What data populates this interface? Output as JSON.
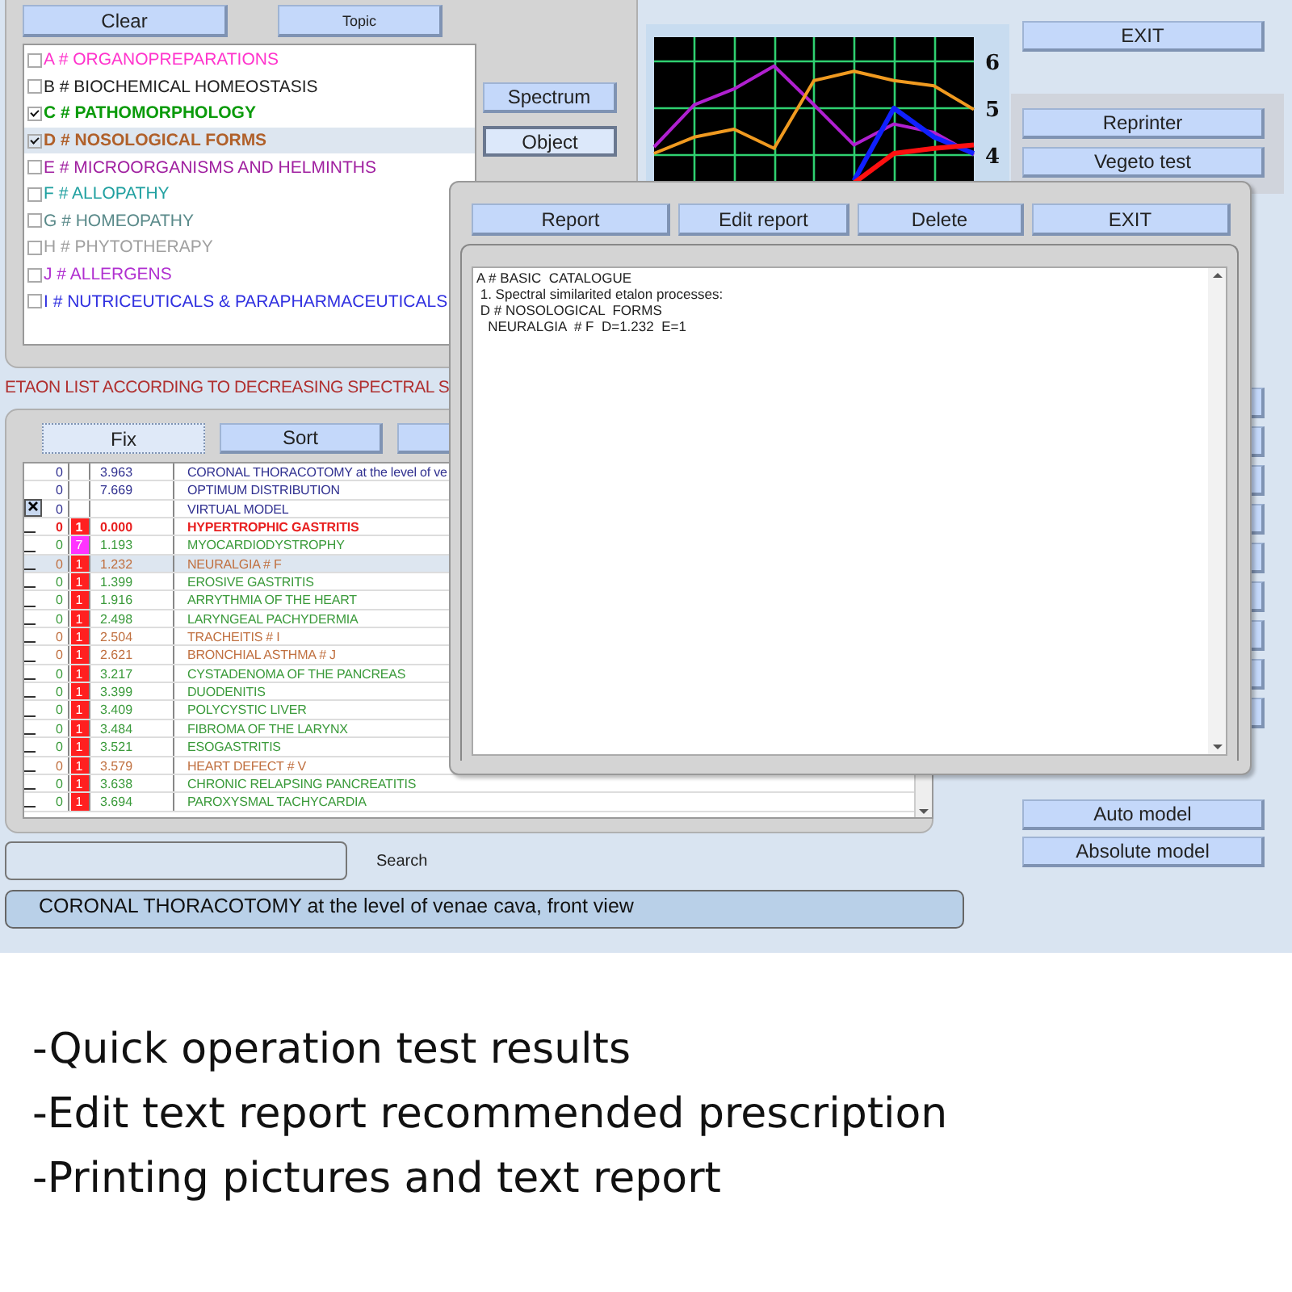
{
  "top_buttons": [
    {
      "label": "Clear"
    },
    {
      "label": "Topic"
    }
  ],
  "categories": [
    {
      "label": "A # ORGANOPREPARATIONS",
      "checked": false,
      "selected": false,
      "color": "#ff33cc"
    },
    {
      "label": "B # BIOCHEMICAL HOMEOSTASIS",
      "checked": false,
      "selected": false,
      "color": "#222222"
    },
    {
      "label": "C # PATHOMORPHOLOGY",
      "checked": true,
      "selected": false,
      "color": "#0a9a0a"
    },
    {
      "label": "D # NOSOLOGICAL  FORMS",
      "checked": true,
      "selected": true,
      "color": "#b0602a"
    },
    {
      "label": "E # MICROORGANISMS AND HELMINTHS",
      "checked": false,
      "selected": false,
      "color": "#a020a0"
    },
    {
      "label": "F # ALLOPATHY",
      "checked": false,
      "selected": false,
      "color": "#20a0a0"
    },
    {
      "label": "G # HOMEOPATHY",
      "checked": false,
      "selected": false,
      "color": "#5a8a8a"
    },
    {
      "label": "H # PHYTOTHERAPY",
      "checked": false,
      "selected": false,
      "color": "#a0a0a0"
    },
    {
      "label": "J # ALLERGENS",
      "checked": false,
      "selected": false,
      "color": "#b030d0"
    },
    {
      "label": "I # NUTRICEUTICALS & PARAPHARMACEUTICALS",
      "checked": false,
      "selected": false,
      "color": "#3030e0"
    }
  ],
  "side_buttons": [
    {
      "label": "Spectrum",
      "selected": false
    },
    {
      "label": "Object",
      "selected": true
    }
  ],
  "chart": {
    "chart_data": {
      "type": "line",
      "grid": true,
      "categories": [
        null,
        null,
        null,
        null,
        null,
        null,
        null,
        null,
        null
      ],
      "ylim": [
        3.34,
        6.52
      ],
      "yticks": [
        {
          "value": 6,
          "label": "6"
        },
        {
          "value": 5,
          "label": "5"
        },
        {
          "value": 4,
          "label": "4"
        }
      ],
      "series": [
        {
          "color": "#b020d0",
          "values": [
            4.17,
            5.07,
            5.41,
            5.9,
            5.07,
            4.21,
            4.66,
            4.48,
            4.0
          ]
        },
        {
          "color": "#f09a20",
          "values": [
            4.03,
            4.38,
            4.55,
            4.14,
            5.59,
            5.79,
            5.59,
            5.48,
            4.97
          ]
        },
        {
          "color": "#1020ff",
          "values": [
            null,
            null,
            null,
            null,
            null,
            3.45,
            5.0,
            4.38,
            4.03
          ]
        },
        {
          "color": "#ff1010",
          "values": [
            null,
            null,
            null,
            null,
            null,
            3.4,
            4.03,
            4.14,
            4.21
          ]
        }
      ]
    }
  },
  "right_buttons": {
    "exit": "EXIT",
    "group": [
      "Reprinter",
      "Vegeto test"
    ],
    "bottom": [
      "Auto model",
      "Absolute model"
    ]
  },
  "list_heading": "ETAON LIST ACCORDING TO DECREASING SPECTRAL S",
  "list_buttons": [
    {
      "label": "Fix",
      "selected": true
    },
    {
      "label": "Sort",
      "selected": false
    }
  ],
  "rows": [
    {
      "kind": "model",
      "checked": false,
      "selected": false,
      "bold": false,
      "color": "#303090",
      "col_1": "0",
      "value": "3.963",
      "name": "CORONAL THORACOTOMY at the level of ve"
    },
    {
      "kind": "model",
      "checked": false,
      "selected": false,
      "bold": false,
      "color": "#303090",
      "col_1": "0",
      "value": "7.669",
      "name": "OPTIMUM DISTRIBUTION"
    },
    {
      "kind": "model",
      "checked": true,
      "selected": false,
      "bold": false,
      "color": "#303090",
      "col_1": "0",
      "name": "VIRTUAL MODEL"
    },
    {
      "kind": "etalon",
      "checked": false,
      "selected": false,
      "bold": true,
      "color": "#e82020",
      "col_1": "0",
      "badge": {
        "text": "1",
        "color": "#ff2020"
      },
      "value": "0.000",
      "name": "HYPERTROPHIC  GASTRITIS"
    },
    {
      "kind": "etalon",
      "checked": false,
      "selected": false,
      "bold": false,
      "color": "#3a9a3a",
      "col_1": "0",
      "badge": {
        "text": "7",
        "color": "#ff33ff"
      },
      "value": "1.193",
      "name": "MYOCARDIODYSTROPHY"
    },
    {
      "kind": "etalon",
      "checked": false,
      "selected": true,
      "bold": false,
      "color": "#c07040",
      "col_1": "0",
      "badge": {
        "text": "1",
        "color": "#ff2020"
      },
      "value": "1.232",
      "name": "NEURALGIA  # F"
    },
    {
      "kind": "etalon",
      "checked": false,
      "selected": false,
      "bold": false,
      "color": "#3a9a3a",
      "col_1": "0",
      "badge": {
        "text": "1",
        "color": "#ff2020"
      },
      "value": "1.399",
      "name": "EROSIVE GASTRITIS"
    },
    {
      "kind": "etalon",
      "checked": false,
      "selected": false,
      "bold": false,
      "color": "#3a9a3a",
      "col_1": "0",
      "badge": {
        "text": "1",
        "color": "#ff2020"
      },
      "value": "1.916",
      "name": "ARRYTHMIA  OF  THE HEART"
    },
    {
      "kind": "etalon",
      "checked": false,
      "selected": false,
      "bold": false,
      "color": "#3a9a3a",
      "col_1": "0",
      "badge": {
        "text": "1",
        "color": "#ff2020"
      },
      "value": "2.498",
      "name": "LARYNGEAL PACHYDERMIA"
    },
    {
      "kind": "etalon",
      "checked": false,
      "selected": false,
      "bold": false,
      "color": "#c07040",
      "col_1": "0",
      "badge": {
        "text": "1",
        "color": "#ff2020"
      },
      "value": "2.504",
      "name": "TRACHEITIS # I"
    },
    {
      "kind": "etalon",
      "checked": false,
      "selected": false,
      "bold": false,
      "color": "#c07040",
      "col_1": "0",
      "badge": {
        "text": "1",
        "color": "#ff2020"
      },
      "value": "2.621",
      "name": "BRONCHIAL  ASTHMA  # J"
    },
    {
      "kind": "etalon",
      "checked": false,
      "selected": false,
      "bold": false,
      "color": "#3a9a3a",
      "col_1": "0",
      "badge": {
        "text": "1",
        "color": "#ff2020"
      },
      "value": "3.217",
      "name": "CYSTADENOMA  OF  THE  PANCREAS"
    },
    {
      "kind": "etalon",
      "checked": false,
      "selected": false,
      "bold": false,
      "color": "#3a9a3a",
      "col_1": "0",
      "badge": {
        "text": "1",
        "color": "#ff2020"
      },
      "value": "3.399",
      "name": "DUODENITIS"
    },
    {
      "kind": "etalon",
      "checked": false,
      "selected": false,
      "bold": false,
      "color": "#3a9a3a",
      "col_1": "0",
      "badge": {
        "text": "1",
        "color": "#ff2020"
      },
      "value": "3.409",
      "name": "POLYCYSTIC  LIVER"
    },
    {
      "kind": "etalon",
      "checked": false,
      "selected": false,
      "bold": false,
      "color": "#3a9a3a",
      "col_1": "0",
      "badge": {
        "text": "1",
        "color": "#ff2020"
      },
      "value": "3.484",
      "name": "FIBROMA  OF  THE  LARYNX"
    },
    {
      "kind": "etalon",
      "checked": false,
      "selected": false,
      "bold": false,
      "color": "#3a9a3a",
      "col_1": "0",
      "badge": {
        "text": "1",
        "color": "#ff2020"
      },
      "value": "3.521",
      "name": "ESOGASTRITIS"
    },
    {
      "kind": "etalon",
      "checked": false,
      "selected": false,
      "bold": false,
      "color": "#c07040",
      "col_1": "0",
      "badge": {
        "text": "1",
        "color": "#ff2020"
      },
      "value": "3.579",
      "name": "HEART DEFECT # V"
    },
    {
      "kind": "etalon",
      "checked": false,
      "selected": false,
      "bold": false,
      "color": "#3a9a3a",
      "col_1": "0",
      "badge": {
        "text": "1",
        "color": "#ff2020"
      },
      "value": "3.638",
      "name": "CHRONIC  RELAPSING  PANCREATITIS"
    },
    {
      "kind": "etalon",
      "checked": false,
      "selected": false,
      "bold": false,
      "color": "#3a9a3a",
      "col_1": "0",
      "badge": {
        "text": "1",
        "color": "#ff2020"
      },
      "value": "3.694",
      "name": "PAROXYSMAL  TACHYCARDIA"
    }
  ],
  "search": {
    "label": "Search"
  },
  "status_bar": "CORONAL THORACOTOMY at the level of venae cava, front view",
  "dialog": {
    "buttons": [
      "Report",
      "Edit report",
      "Delete",
      "EXIT"
    ],
    "report_lines": [
      "A # BASIC  CATALOGUE",
      " 1. Spectral similarited etalon processes:",
      " D # NOSOLOGICAL  FORMS",
      "   NEURALGIA  # F  D=1.232  E=1"
    ]
  },
  "captions": [
    "-Quick operation test results",
    "-Edit text report recommended prescription",
    "-Printing pictures and text report"
  ]
}
